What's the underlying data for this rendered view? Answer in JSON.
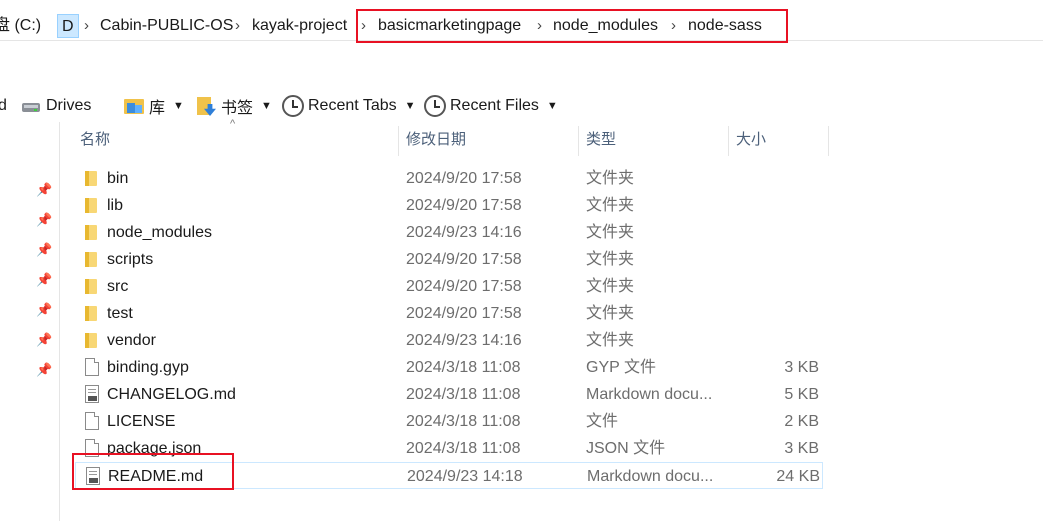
{
  "address_bar": {
    "crumbs": [
      "盘 (C:)",
      "D",
      "Cabin-PUBLIC-OS",
      "kayak-project",
      "basicmarketingpage",
      "node_modules",
      "node-sass"
    ]
  },
  "toolbar": {
    "partial_label": "d",
    "drives": "Drives",
    "library": "库",
    "bookmarks": "书签",
    "recent_tabs": "Recent Tabs",
    "recent_files": "Recent Files"
  },
  "columns": {
    "name": "名称",
    "date": "修改日期",
    "type": "类型",
    "size": "大小"
  },
  "files": [
    {
      "name": "bin",
      "date": "2024/9/20 17:58",
      "type": "文件夹",
      "size": "",
      "icon": "folder-icon"
    },
    {
      "name": "lib",
      "date": "2024/9/20 17:58",
      "type": "文件夹",
      "size": "",
      "icon": "folder-icon"
    },
    {
      "name": "node_modules",
      "date": "2024/9/23 14:16",
      "type": "文件夹",
      "size": "",
      "icon": "folder-icon"
    },
    {
      "name": "scripts",
      "date": "2024/9/20 17:58",
      "type": "文件夹",
      "size": "",
      "icon": "folder-icon"
    },
    {
      "name": "src",
      "date": "2024/9/20 17:58",
      "type": "文件夹",
      "size": "",
      "icon": "folder-icon"
    },
    {
      "name": "test",
      "date": "2024/9/20 17:58",
      "type": "文件夹",
      "size": "",
      "icon": "folder-icon"
    },
    {
      "name": "vendor",
      "date": "2024/9/23 14:16",
      "type": "文件夹",
      "size": "",
      "icon": "folder-icon"
    },
    {
      "name": "binding.gyp",
      "date": "2024/3/18 11:08",
      "type": "GYP 文件",
      "size": "3 KB",
      "icon": "file-icon"
    },
    {
      "name": "CHANGELOG.md",
      "date": "2024/3/18 11:08",
      "type": "Markdown docu...",
      "size": "5 KB",
      "icon": "markdown-file-icon"
    },
    {
      "name": "LICENSE",
      "date": "2024/3/18 11:08",
      "type": "文件",
      "size": "2 KB",
      "icon": "file-icon"
    },
    {
      "name": "package.json",
      "date": "2024/3/18 11:08",
      "type": "JSON 文件",
      "size": "3 KB",
      "icon": "file-icon"
    },
    {
      "name": "README.md",
      "date": "2024/9/23 14:18",
      "type": "Markdown docu...",
      "size": "24 KB",
      "icon": "markdown-file-icon"
    }
  ],
  "pins": [
    "pin-icon",
    "pin-icon",
    "pin-icon",
    "pin-icon",
    "pin-icon",
    "pin-icon",
    "pin-icon"
  ],
  "colors": {
    "highlight_red": "#e81123",
    "selection_blue": "#cce8ff",
    "header_text": "#4c607a"
  }
}
